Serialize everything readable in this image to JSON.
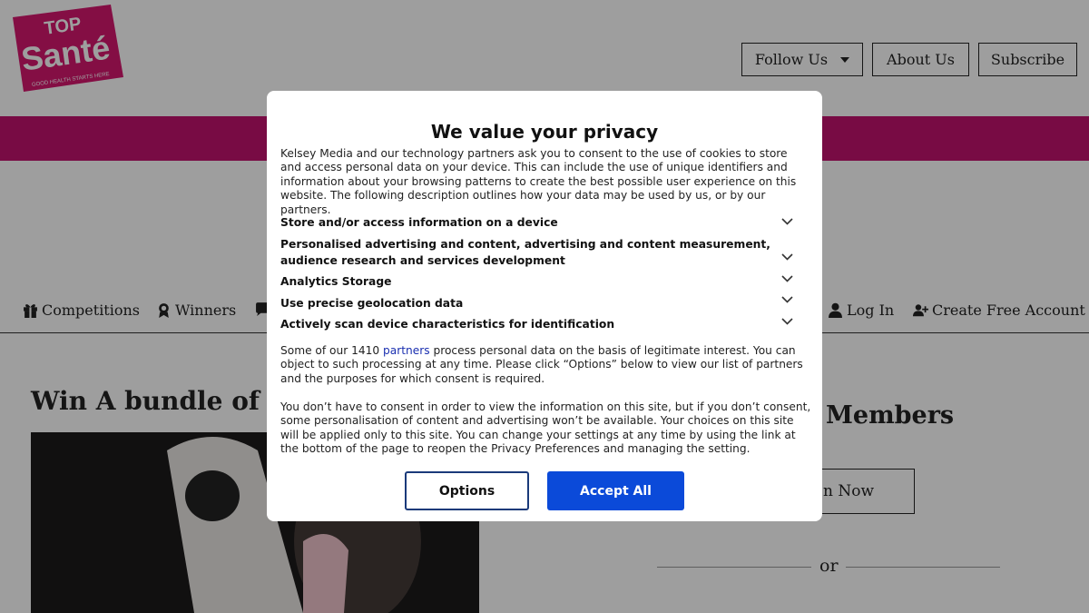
{
  "header": {
    "logo_text": "TOP Santé",
    "logo_tagline": "GOOD HEALTH STARTS HERE",
    "buttons": {
      "follow": "Follow Us",
      "about": "About Us",
      "subscribe": "Subscribe"
    }
  },
  "nav": {
    "competitions": "Competitions",
    "winners": "Winners",
    "login": "Log In",
    "create_account": "Create Free Account"
  },
  "article": {
    "title": "Win A bundle of Re"
  },
  "sidebar": {
    "members_heading": "Members",
    "join_button": "n Now",
    "or_text": "or"
  },
  "colors": {
    "brand_pink": "#c2126e",
    "accept_blue": "#0b4ad9",
    "link_blue": "#1a2fb0"
  },
  "dialog": {
    "title": "We value your privacy",
    "intro": "Kelsey Media and our technology partners ask you to consent to the use of cookies to store and access personal data on your device. This can include the use of unique identifiers and information about your browsing patterns to create the best possible user experience on this website. The following description outlines how your data may be used by us, or by our partners.",
    "purposes": [
      "Store and/or access information on a device",
      "Personalised advertising and content, advertising and content measurement, audience research and services development",
      "Analytics Storage",
      "Use precise geolocation data",
      "Actively scan device characteristics for identification"
    ],
    "legit_before": "Some of our 1410 ",
    "legit_link": "partners",
    "legit_after": " process personal data on the basis of legitimate interest. You can object to such processing at any time. Please click “Options” below to view our list of partners and the purposes for which consent is required.",
    "no_consent": "You don’t have to consent in order to view the information on this site, but if you don’t consent, some personalisation of content and advertising won’t be available. Your choices on this site will be applied only to this site. You can change your settings at any time by using the link at the bottom of the page to reopen the Privacy Preferences and managing the setting.",
    "options_label": "Options",
    "accept_label": "Accept All"
  }
}
